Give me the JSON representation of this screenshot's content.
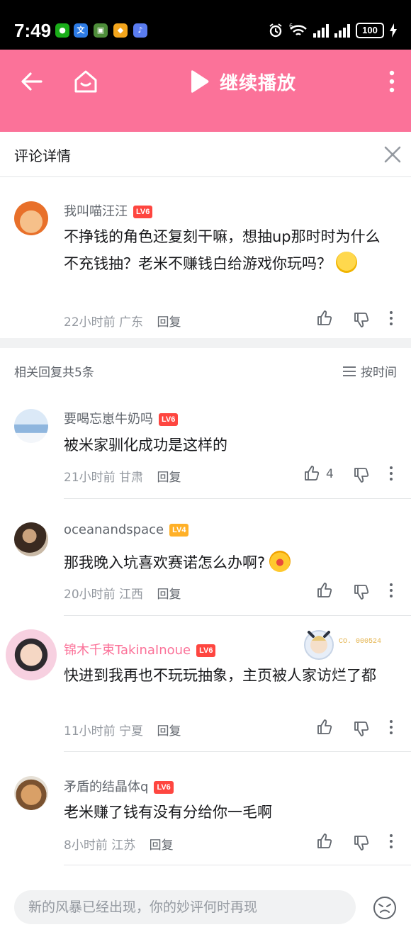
{
  "status_bar": {
    "time": "7:49",
    "battery": "100",
    "signal_badge": "6"
  },
  "header": {
    "play_label": "继续播放"
  },
  "detail": {
    "title": "评论详情"
  },
  "main_comment": {
    "username": "我叫喵汪汪",
    "level": "LV6",
    "text": "不挣钱的角色还复刻干嘛，想抽up那时时为什么不充钱抽？老米不赚钱白给游戏你玩吗？",
    "time": "22小时前",
    "location": "广东",
    "reply_label": "回复"
  },
  "replies_header": {
    "count_label": "相关回复共5条",
    "sort_label": "按时间"
  },
  "replies": [
    {
      "username": "要喝忘崽牛奶吗",
      "level": "LV6",
      "text": "被米家驯化成功是这样的",
      "time": "21小时前",
      "location": "甘肃",
      "reply_label": "回复",
      "like_count": "4"
    },
    {
      "username": "oceanandspace",
      "level": "LV4",
      "text": "那我晚入坑喜欢赛诺怎么办啊?",
      "time": "20小时前",
      "location": "江西",
      "reply_label": "回复"
    },
    {
      "username": "锦木千束TakinaInoue",
      "level": "LV6",
      "text": "快进到我再也不玩玩抽象，主页被人家访烂了都",
      "time": "11小时前",
      "location": "宁夏",
      "reply_label": "回复",
      "fan_badge": "CO. 000524"
    },
    {
      "username": "矛盾的结晶体q",
      "level": "LV6",
      "text": "老米赚了钱有没有分给你一毛啊",
      "time": "8小时前",
      "location": "江苏",
      "reply_label": "回复"
    }
  ],
  "input": {
    "placeholder": "新的风暴已经出现，你的妙评何时再现"
  },
  "colors": {
    "accent": "#fb7299",
    "level6": "#fe4640",
    "level4": "#ffb027"
  }
}
